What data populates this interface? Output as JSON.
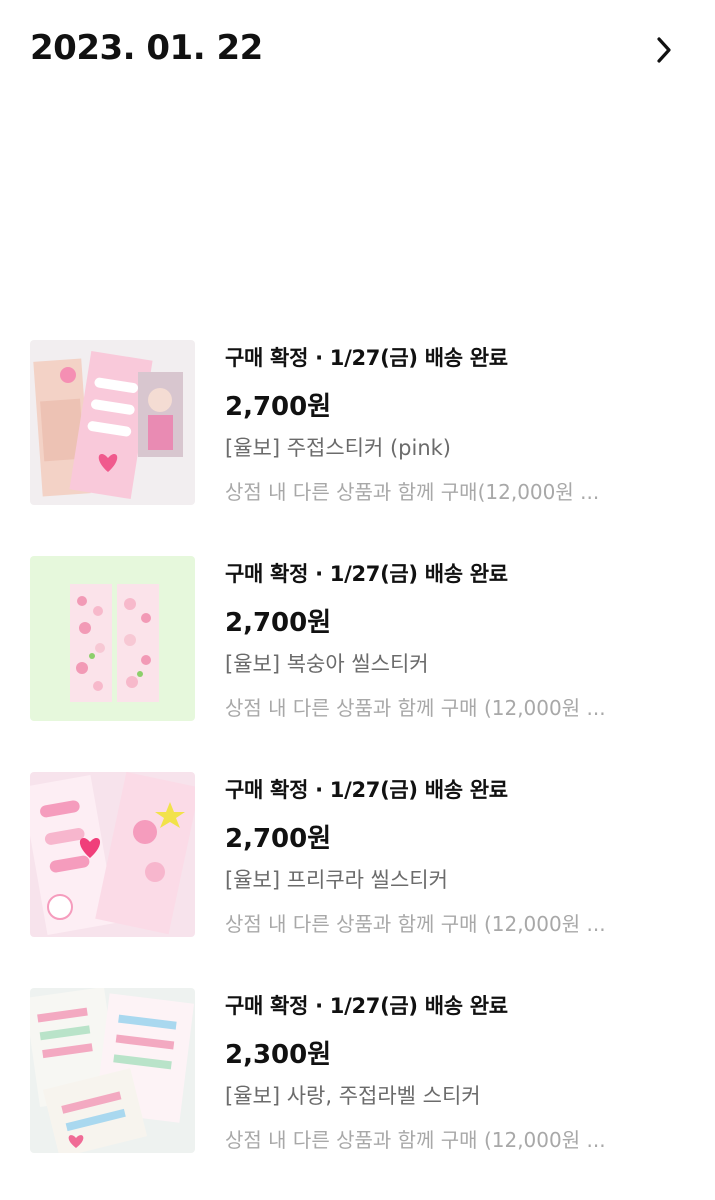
{
  "header": {
    "date": "2023. 01. 22",
    "chevron_icon": "chevron-right-icon"
  },
  "orders": [
    {
      "status": "구매 확정 · 1/27(금) 배송 완료",
      "price": "2,700원",
      "product": "[율보] 주접스티커 (pink)",
      "note": "상점 내 다른 상품과 함께 구매(12,000원 ...",
      "thumb_bg": "#f2eef0"
    },
    {
      "status": "구매 확정 · 1/27(금) 배송 완료",
      "price": "2,700원",
      "product": "[율보] 복숭아 씰스티커",
      "note": "상점 내 다른 상품과 함께 구매 (12,000원 ...",
      "thumb_bg": "#e6f8dc"
    },
    {
      "status": "구매 확정 · 1/27(금) 배송 완료",
      "price": "2,700원",
      "product": "[율보] 프리쿠라 씰스티커",
      "note": "상점 내 다른 상품과 함께 구매 (12,000원 ...",
      "thumb_bg": "#f7e3ec"
    },
    {
      "status": "구매 확정 · 1/27(금) 배송 완료",
      "price": "2,300원",
      "product": "[율보] 사랑, 주접라벨 스티커",
      "note": "상점 내 다른 상품과 함께 구매 (12,000원 ...",
      "thumb_bg": "#eef2f0"
    }
  ]
}
